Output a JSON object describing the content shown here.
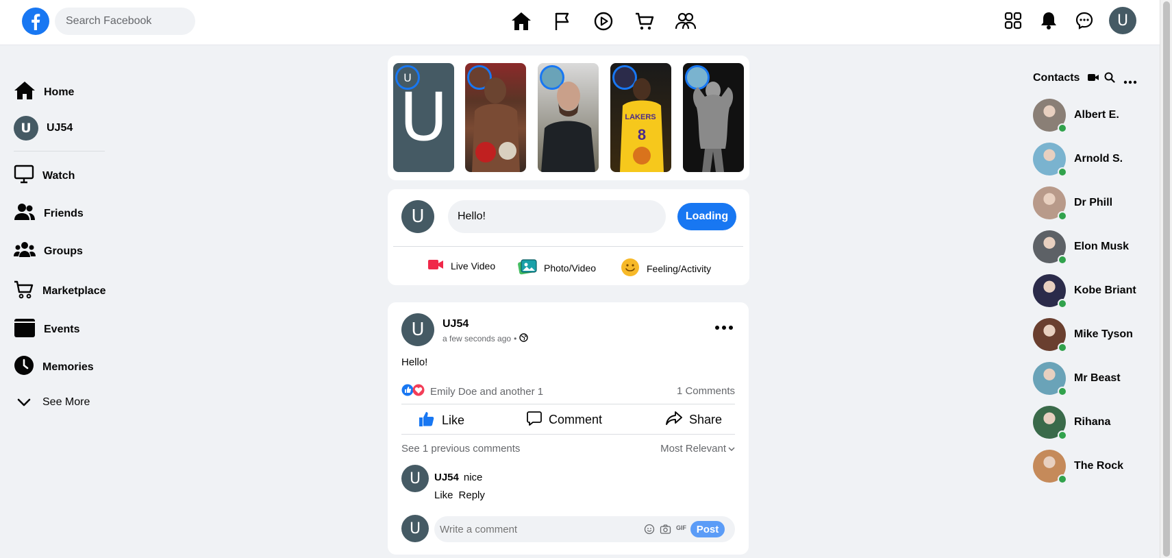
{
  "search": {
    "placeholder": "Search Facebook"
  },
  "topbar": {
    "nav_icons": [
      "home-icon",
      "flag-icon",
      "watch-play-icon",
      "marketplace-cart-icon",
      "groups-icon"
    ],
    "right_icons": [
      "menu-grid-icon",
      "notifications-bell-icon",
      "messenger-icon"
    ],
    "profile_initial": "U"
  },
  "sidebar": {
    "items": [
      {
        "label": "Home",
        "icon": "home-icon"
      },
      {
        "label": "UJ54",
        "icon": "avatar"
      },
      {
        "label": "Watch",
        "icon": "monitor-icon"
      },
      {
        "label": "Friends",
        "icon": "friends-icon"
      },
      {
        "label": "Groups",
        "icon": "groups-icon"
      },
      {
        "label": "Marketplace",
        "icon": "cart-icon"
      },
      {
        "label": "Events",
        "icon": "calendar-icon"
      },
      {
        "label": "Memories",
        "icon": "clock-icon"
      },
      {
        "label": "See More",
        "icon": "chevron-down-icon"
      }
    ],
    "avatar_initial": "U"
  },
  "stories": {
    "own_initial": "U",
    "ring_initial": "U"
  },
  "composer": {
    "avatar_initial": "U",
    "input_value": "Hello!",
    "submit_label": "Loading",
    "actions": [
      {
        "label": "Live Video",
        "icon": "video-camera-icon"
      },
      {
        "label": "Photo/Video",
        "icon": "photo-icon"
      },
      {
        "label": "Feeling/Activity",
        "icon": "smiley-icon"
      }
    ]
  },
  "post": {
    "avatar_initial": "U",
    "author": "UJ54",
    "time": "a few seconds ago",
    "separator": "•",
    "text": "Hello!",
    "reactions_text": "Emily Doe and another 1",
    "comments_count": "1 Comments",
    "actions": {
      "like": "Like",
      "comment": "Comment",
      "share": "Share"
    },
    "previous_comments": "See 1 previous comments",
    "sort_label": "Most Relevant",
    "comment": {
      "avatar_initial": "U",
      "author": "UJ54",
      "text": "nice",
      "like": "Like",
      "reply": "Reply"
    },
    "write_comment": {
      "avatar_initial": "U",
      "placeholder": "Write a comment",
      "gif": "GIF",
      "post_label": "Post"
    }
  },
  "contacts": {
    "title": "Contacts",
    "people": [
      {
        "name": "Albert E.",
        "color": "#8a7f76"
      },
      {
        "name": "Arnold S.",
        "color": "#7ab3cf"
      },
      {
        "name": "Dr Phill",
        "color": "#b89a8a"
      },
      {
        "name": "Elon Musk",
        "color": "#5d6166"
      },
      {
        "name": "Kobe Briant",
        "color": "#2b2b4a"
      },
      {
        "name": "Mike Tyson",
        "color": "#6a3f2f"
      },
      {
        "name": "Mr Beast",
        "color": "#6aa3b8"
      },
      {
        "name": "Rihana",
        "color": "#3a6a4a"
      },
      {
        "name": "The Rock",
        "color": "#c58a5a"
      }
    ]
  },
  "colors": {
    "accent": "#1877f2",
    "online": "#31a24c",
    "avatar_bg": "#455a64"
  }
}
